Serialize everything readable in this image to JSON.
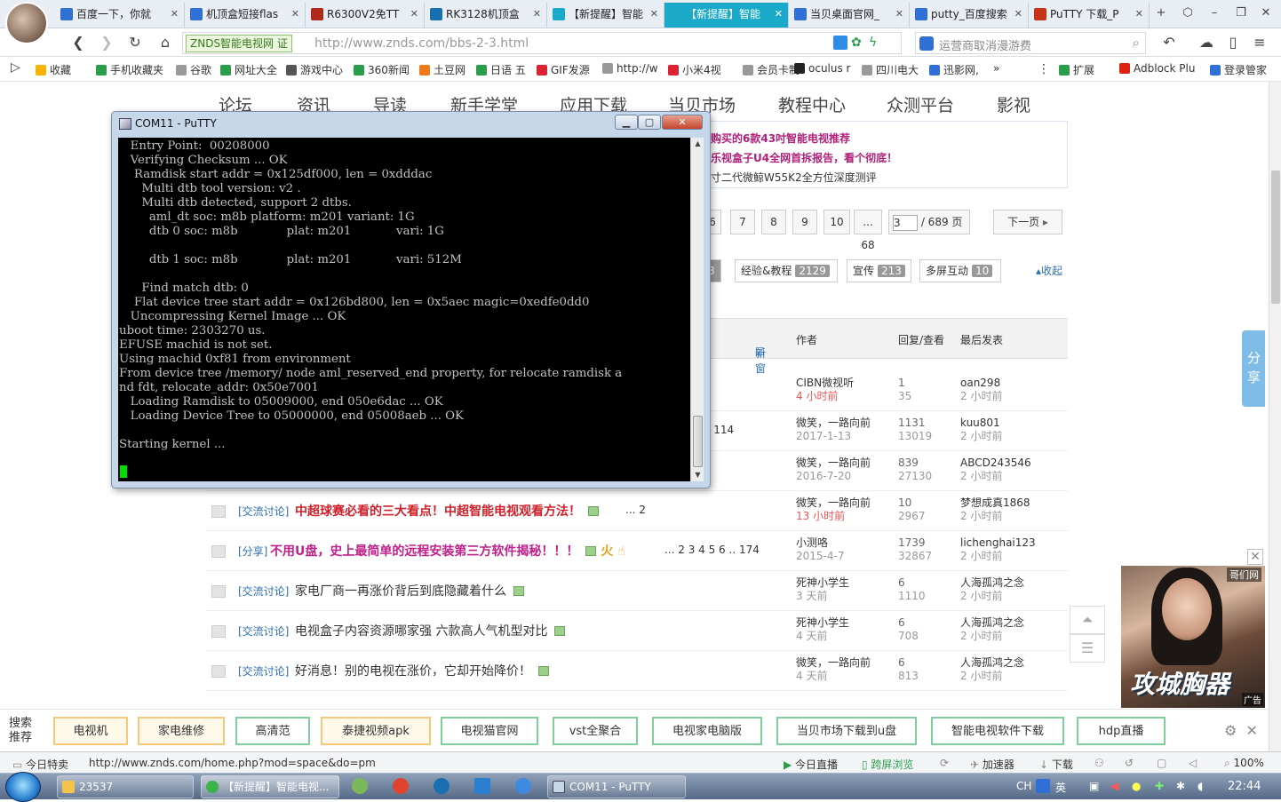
{
  "browser": {
    "tabs": [
      {
        "label": "百度一下，你就",
        "color": "#2f6fd6"
      },
      {
        "label": "机顶盒短接flas",
        "color": "#2f6fd6"
      },
      {
        "label": "R6300V2免TT",
        "color": "#b02a1a"
      },
      {
        "label": "RK3128机顶盒",
        "color": "#1a6fb0"
      },
      {
        "label": "【新提醒】智能",
        "color": "#1aa9c9"
      },
      {
        "label": "【新提醒】智能",
        "color": "#1aa9c9"
      },
      {
        "label": "当贝桌面官网_",
        "color": "#2f6fd6"
      },
      {
        "label": "putty_百度搜索",
        "color": "#2f6fd6"
      },
      {
        "label": "PuTTY 下载_P",
        "color": "#c8341a"
      }
    ],
    "new_tab": "+",
    "site_badge": "ZNDS智能电视网 证",
    "url": "http://www.znds.com/bbs-2-3.html",
    "search_placeholder": "运营商取消漫游费",
    "bookmarks": [
      {
        "label": "收藏",
        "color": "#f5b400"
      },
      {
        "label": "手机收藏夹",
        "color": "#2a9d4a"
      },
      {
        "label": "谷歌",
        "color": "#999999"
      },
      {
        "label": "网址大全",
        "color": "#2a9d4a"
      },
      {
        "label": "游戏中心",
        "color": "#555555"
      },
      {
        "label": "360新闻",
        "color": "#2a9d4a"
      },
      {
        "label": "土豆网",
        "color": "#f07a1a"
      },
      {
        "label": "日语 五",
        "color": "#2a9d4a"
      },
      {
        "label": "GIF发源",
        "color": "#d23"
      },
      {
        "label": "http://w",
        "color": "#999999"
      },
      {
        "label": "小米4视",
        "color": "#d23"
      },
      {
        "label": "会员卡制",
        "color": "#999999"
      },
      {
        "label": "oculus r",
        "color": "#222222"
      },
      {
        "label": "四川电大",
        "color": "#999999"
      },
      {
        "label": "迅影网,",
        "color": "#2f6fd6"
      }
    ],
    "right_tools": {
      "more": "»",
      "ext": "扩展",
      "adblock": "Adblock Plu",
      "login": "登录管家"
    }
  },
  "site": {
    "nav": [
      "论坛",
      "资讯",
      "导读",
      "新手学堂",
      "应用下载",
      "当贝市场",
      "教程中心",
      "众测平台",
      "影视"
    ],
    "promos": [
      {
        "text": "购买的6款43吋智能电视推荐",
        "color": "#b0207a"
      },
      {
        "text": "乐视盒子U4全网首拆报告，看个彻底！",
        "color": "#b0207a"
      },
      {
        "text": "寸二代微鲸W55K2全方位深度测评",
        "color": "#333333"
      }
    ],
    "pager": {
      "p6": "6",
      "p7": "7",
      "p8": "8",
      "p9": "9",
      "p10": "10",
      "ellipsis68": "... 68",
      "input": "3",
      "total": "/ 689 页",
      "next": "下一页"
    },
    "categories": [
      {
        "label": "8",
        "count": ""
      },
      {
        "label": "经验&教程",
        "count": "2129"
      },
      {
        "label": "宣传",
        "count": "213"
      },
      {
        "label": "多屏互动",
        "count": "10"
      }
    ],
    "collapse": "收起",
    "list_header": {
      "newwin": "新窗",
      "author": "作者",
      "reply": "回复/查看",
      "last": "最后发表"
    },
    "rows": [
      {
        "tag": "",
        "title": "",
        "title_color": "#333333",
        "pages": "",
        "author": "CIBN微视听",
        "date": "4 小时前",
        "date_red": true,
        "reply": "1",
        "views": "35",
        "last_user": "oan298",
        "last_time": "2 小时前"
      },
      {
        "tag": "",
        "title": "",
        "title_color": "#333333",
        "pages": "... 114",
        "author": "微笑，一路向前",
        "date": "2017-1-13",
        "date_red": false,
        "reply": "1131",
        "views": "13019",
        "last_user": "kuu801",
        "last_time": "2 小时前"
      },
      {
        "tag": "",
        "title": "",
        "title_color": "#333333",
        "pages": "",
        "author": "微笑，一路向前",
        "date": "2016-7-20",
        "date_red": false,
        "reply": "839",
        "views": "27130",
        "last_user": "ABCD243546",
        "last_time": "2 小时前"
      },
      {
        "tag": "[交流讨论]",
        "title": "中超球赛必看的三大看点！中超智能电视观看方法！",
        "title_color": "#d0202a",
        "pages": "... 2",
        "author": "微笑，一路向前",
        "date": "13 小时前",
        "date_red": true,
        "reply": "10",
        "views": "2967",
        "last_user": "梦想成真1868",
        "last_time": "2 小时前"
      },
      {
        "tag": "[分享]",
        "title": "不用U盘，史上最简单的远程安装第三方软件揭秘！！！",
        "title_color": "#c0208a",
        "pages": "... 2  3  4  5  6 .. 174",
        "author": "小测咯",
        "date": "2015-4-7",
        "date_red": false,
        "reply": "1739",
        "views": "32867",
        "last_user": "lichenghai123",
        "last_time": "2 小时前"
      },
      {
        "tag": "[交流讨论]",
        "title": "家电厂商一再涨价背后到底隐藏着什么",
        "title_color": "#333333",
        "pages": "",
        "author": "死神小学生",
        "date": "3 天前",
        "date_red": false,
        "reply": "6",
        "views": "1110",
        "last_user": "人海孤鸿之念",
        "last_time": "2 小时前"
      },
      {
        "tag": "[交流讨论]",
        "title": "电视盒子内容资源哪家强 六款高人气机型对比",
        "title_color": "#333333",
        "pages": "",
        "author": "死神小学生",
        "date": "4 天前",
        "date_red": false,
        "reply": "6",
        "views": "708",
        "last_user": "人海孤鸿之念",
        "last_time": "2 小时前"
      },
      {
        "tag": "[交流讨论]",
        "title": "好消息！别的电视在涨价，它却开始降价！",
        "title_color": "#333333",
        "pages": "",
        "author": "微笑，一路向前",
        "date": "4 天前",
        "date_red": false,
        "reply": "6",
        "views": "813",
        "last_user": "人海孤鸿之念",
        "last_time": "2 小时前"
      }
    ],
    "share": "分享",
    "ad": {
      "source": "哥们网",
      "title": "攻城胸器",
      "label": "广告"
    }
  },
  "putty": {
    "title": "COM11 - PuTTY",
    "lines": [
      "   Entry Point:  00208000",
      "   Verifying Checksum ... OK",
      "    Ramdisk start addr = 0x125df000, len = 0xdddac",
      "      Multi dtb tool version: v2 .",
      "      Multi dtb detected, support 2 dtbs.",
      "        aml_dt soc: m8b platform: m201 variant: 1G",
      "        dtb 0 soc: m8b             plat: m201            vari: 1G",
      "",
      "        dtb 1 soc: m8b             plat: m201            vari: 512M",
      "",
      "      Find match dtb: 0",
      "    Flat device tree start addr = 0x126bd800, len = 0x5aec magic=0xedfe0dd0",
      "   Uncompressing Kernel Image ... OK",
      "uboot time: 2303270 us.",
      "EFUSE machid is not set.",
      "Using machid 0xf81 from environment",
      "From device tree /memory/ node aml_reserved_end property, for relocate ramdisk a",
      "nd fdt, relocate_addr: 0x50e7001",
      "   Loading Ramdisk to 05009000, end 050e6dac ... OK",
      "   Loading Device Tree to 05000000, end 05008aeb ... OK",
      "",
      "Starting kernel ..."
    ]
  },
  "recommend": {
    "label_line1": "搜索",
    "label_line2": "推荐",
    "items": [
      "电视机",
      "家电维修",
      "高清范",
      "泰捷视频apk",
      "电视猫官网",
      "vst全聚合",
      "电视家电脑版",
      "当贝市场下载到u盘",
      "智能电视软件下载",
      "hdp直播"
    ]
  },
  "statusbar": {
    "left": "今日特卖",
    "url": "http://www.znds.com/home.php?mod=space&do=pm",
    "live": "今日直播",
    "cross": "跨屏浏览",
    "accel": "加速器",
    "download": "下载",
    "zoom": "100%"
  },
  "taskbar": {
    "items": [
      "23537",
      "【新提醒】智能电视...",
      "COM11 - PuTTY"
    ],
    "ime": "CH",
    "lang": "英",
    "time": "22:44"
  }
}
